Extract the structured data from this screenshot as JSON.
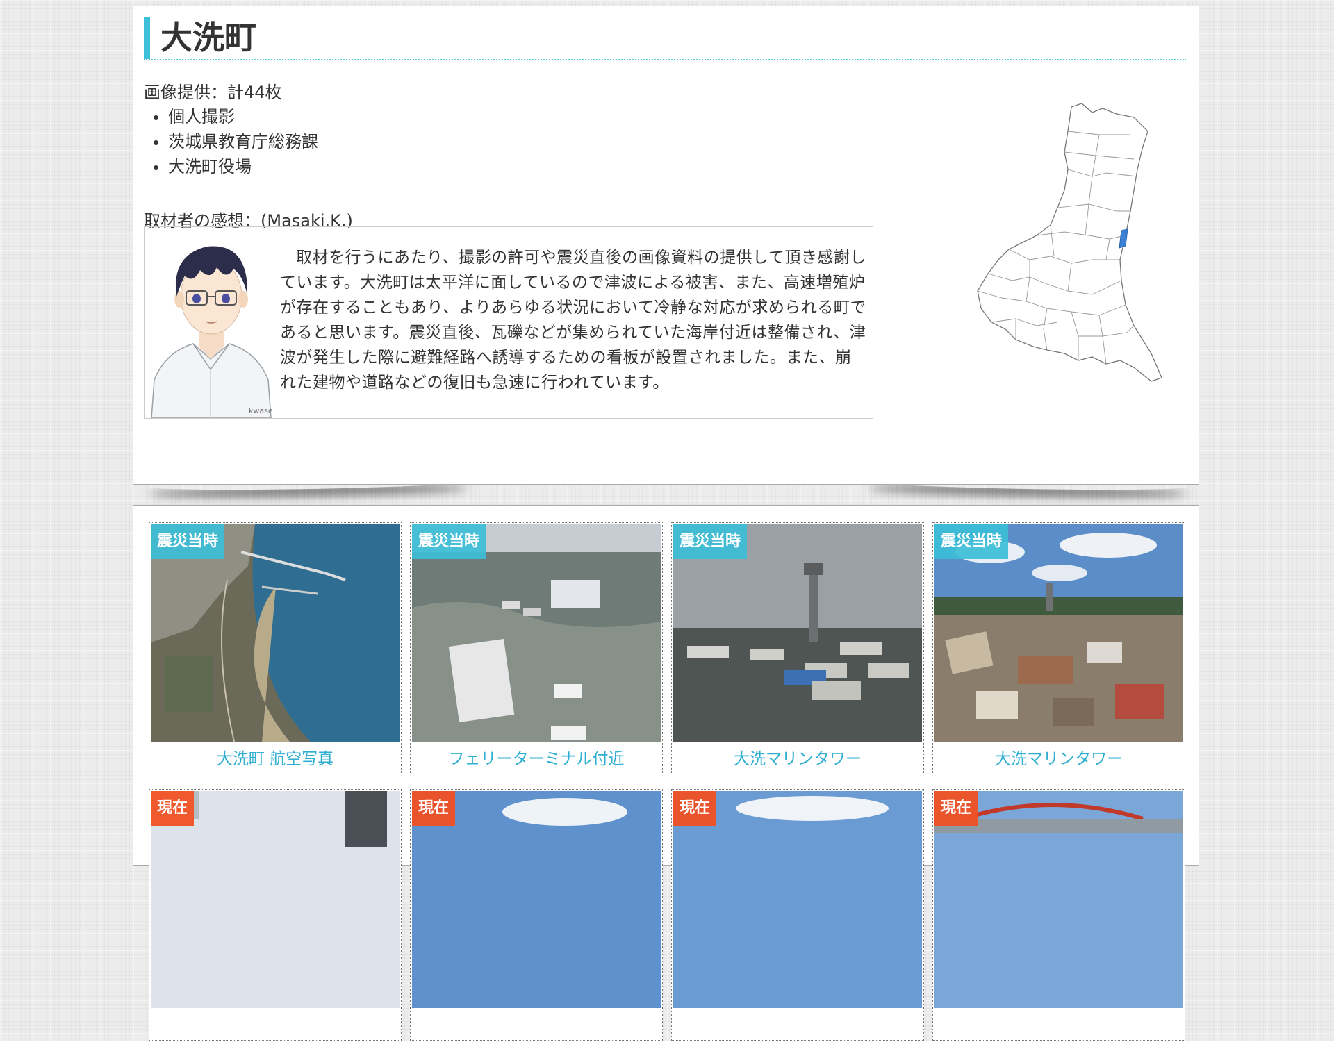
{
  "header": {
    "title": "大洗町"
  },
  "credits": {
    "heading": "画像提供：計44枚",
    "items": [
      "個人撮影",
      "茨城県教育庁総務課",
      "大洗町役場"
    ]
  },
  "review": {
    "heading": "取材者の感想：(Masaki.K.)",
    "avatar_signature": "kwase",
    "text": "取材を行うにあたり、撮影の許可や震災直後の画像資料の提供して頂き感謝しています。大洗町は太平洋に面しているので津波による被害、また、高速増殖炉が存在することもあり、よりあらゆる状況において冷静な対応が求められる町であると思います。震災直後、瓦礫などが集められていた海岸付近は整備され、津波が発生した際に避難経路へ誘導するための看板が設置されました。また、崩れた建物や道路などの復旧も急速に行われています。"
  },
  "map": {
    "highlight_color": "#3b82d6",
    "label": "map-ibaraki"
  },
  "gallery": {
    "badge_past": "震災当時",
    "badge_now": "現在",
    "colors": {
      "past": "#3cbed7",
      "now": "#f05023",
      "caption": "#2eaed0"
    },
    "cards": [
      {
        "badge": "震災当時",
        "caption": "大洗町 航空写真"
      },
      {
        "badge": "震災当時",
        "caption": "フェリーターミナル付近"
      },
      {
        "badge": "震災当時",
        "caption": "大洗マリンタワー"
      },
      {
        "badge": "震災当時",
        "caption": "大洗マリンタワー"
      },
      {
        "badge": "現在",
        "caption": ""
      },
      {
        "badge": "現在",
        "caption": ""
      },
      {
        "badge": "現在",
        "caption": ""
      },
      {
        "badge": "現在",
        "caption": ""
      }
    ]
  }
}
